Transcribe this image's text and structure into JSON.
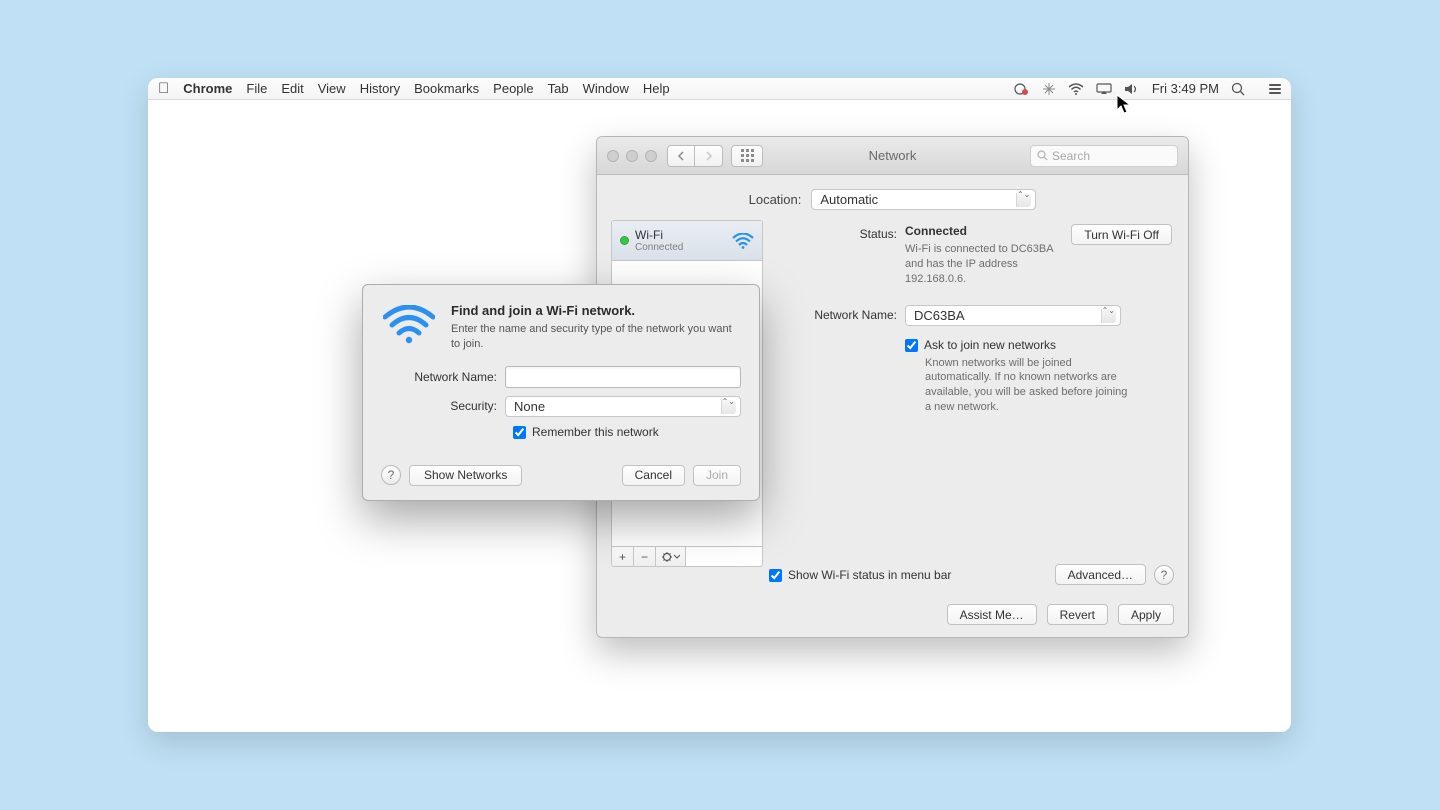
{
  "menubar": {
    "app": "Chrome",
    "items": [
      "File",
      "Edit",
      "View",
      "History",
      "Bookmarks",
      "People",
      "Tab",
      "Window",
      "Help"
    ],
    "clock": "Fri 3:49 PM"
  },
  "network": {
    "title": "Network",
    "search_placeholder": "Search",
    "location_label": "Location:",
    "location_value": "Automatic",
    "sidebar": {
      "wifi_title": "Wi-Fi",
      "wifi_sub": "Connected"
    },
    "status_label": "Status:",
    "status_value": "Connected",
    "turn_off": "Turn Wi-Fi Off",
    "status_info": "Wi-Fi is connected to DC63BA and has the IP address 192.168.0.6.",
    "network_name_label": "Network Name:",
    "network_name_value": "DC63BA",
    "ask_join": "Ask to join new networks",
    "ask_join_info": "Known networks will be joined automatically. If no known networks are available, you will be asked before joining a new network.",
    "show_status": "Show Wi-Fi status in menu bar",
    "advanced": "Advanced…",
    "assist": "Assist Me…",
    "revert": "Revert",
    "apply": "Apply"
  },
  "dialog": {
    "title": "Find and join a Wi-Fi network.",
    "desc": "Enter the name and security type of the network you want to join.",
    "network_name_label": "Network Name:",
    "security_label": "Security:",
    "security_value": "None",
    "remember": "Remember this network",
    "show_networks": "Show Networks",
    "cancel": "Cancel",
    "join": "Join"
  }
}
